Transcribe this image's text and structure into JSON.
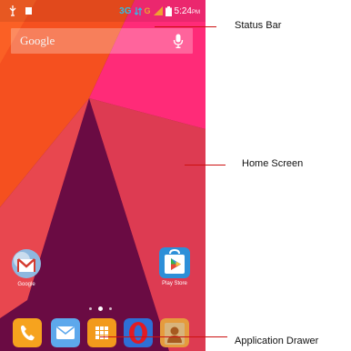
{
  "status_bar": {
    "network_3g": "3G",
    "network_g": "G",
    "time": "5:24",
    "time_suffix": "PM",
    "icons": [
      "usb-icon",
      "notification-icon",
      "signal-icon",
      "battery-icon"
    ]
  },
  "search": {
    "label": "Google",
    "icon": "mic-icon"
  },
  "home_apps": [
    {
      "label": "Google",
      "icon": "gmail-folder-icon"
    },
    {
      "label": "Play Store",
      "icon": "play-store-icon"
    }
  ],
  "page_indicator": {
    "pages": 3,
    "active_index": 1
  },
  "dock": [
    "phone-icon",
    "messages-icon",
    "app-drawer-icon",
    "opera-icon",
    "contacts-icon"
  ],
  "annotations": {
    "status_bar": "Status Bar",
    "home_screen": "Home Screen",
    "app_drawer": "Application Drawer"
  },
  "colors": {
    "wallpaper_orange": "#f5501f",
    "wallpaper_pink": "#ff2b78",
    "wallpaper_purple": "#6a0b43",
    "callout_line": "#cc1010"
  }
}
